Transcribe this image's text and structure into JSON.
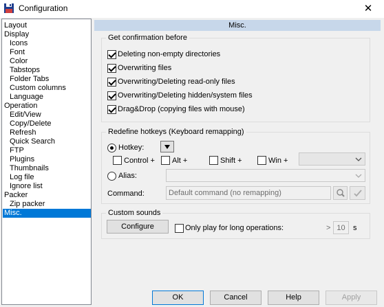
{
  "window": {
    "title": "Configuration",
    "close_glyph": "✕",
    "icon": "floppy-disk-icon"
  },
  "tree": {
    "items": [
      {
        "label": "Layout",
        "indent": 0
      },
      {
        "label": "Display",
        "indent": 0
      },
      {
        "label": "Icons",
        "indent": 1
      },
      {
        "label": "Font",
        "indent": 1
      },
      {
        "label": "Color",
        "indent": 1
      },
      {
        "label": "Tabstops",
        "indent": 1
      },
      {
        "label": "Folder Tabs",
        "indent": 1
      },
      {
        "label": "Custom columns",
        "indent": 1
      },
      {
        "label": "Language",
        "indent": 1
      },
      {
        "label": "Operation",
        "indent": 0
      },
      {
        "label": "Edit/View",
        "indent": 1
      },
      {
        "label": "Copy/Delete",
        "indent": 1
      },
      {
        "label": "Refresh",
        "indent": 1
      },
      {
        "label": "Quick Search",
        "indent": 1
      },
      {
        "label": "FTP",
        "indent": 1
      },
      {
        "label": "Plugins",
        "indent": 1
      },
      {
        "label": "Thumbnails",
        "indent": 1
      },
      {
        "label": "Log file",
        "indent": 1
      },
      {
        "label": "Ignore list",
        "indent": 1
      },
      {
        "label": "Packer",
        "indent": 0
      },
      {
        "label": "Zip packer",
        "indent": 1
      },
      {
        "label": "Misc.",
        "indent": 0,
        "selected": true
      }
    ]
  },
  "panel": {
    "title": "Misc."
  },
  "confirm": {
    "group_label": "Get confirmation before",
    "items": [
      {
        "label": "Deleting non-empty directories",
        "checked": true
      },
      {
        "label": "Overwriting files",
        "checked": true
      },
      {
        "label": "Overwriting/Deleting read-only files",
        "checked": true
      },
      {
        "label": "Overwriting/Deleting hidden/system files",
        "checked": true
      },
      {
        "label": "Drag&Drop (copying files with mouse)",
        "checked": true
      }
    ]
  },
  "hotkeys": {
    "group_label": "Redefine hotkeys (Keyboard remapping)",
    "hotkey_label": "Hotkey:",
    "modifiers": [
      {
        "label": "Control +",
        "checked": false
      },
      {
        "label": "Alt +",
        "checked": false
      },
      {
        "label": "Shift +",
        "checked": false
      },
      {
        "label": "Win +",
        "checked": false
      }
    ],
    "alias_label": "Alias:",
    "command_label": "Command:",
    "command_placeholder": "Default command (no remapping)"
  },
  "sounds": {
    "group_label": "Custom sounds",
    "configure_label": "Configure",
    "long_ops_label": "Only play for long operations:",
    "long_ops_checked": false,
    "threshold_prefix": "> ",
    "threshold_value": "10",
    "threshold_unit": "s"
  },
  "buttons": {
    "ok": "OK",
    "cancel": "Cancel",
    "help": "Help",
    "apply": "Apply"
  }
}
